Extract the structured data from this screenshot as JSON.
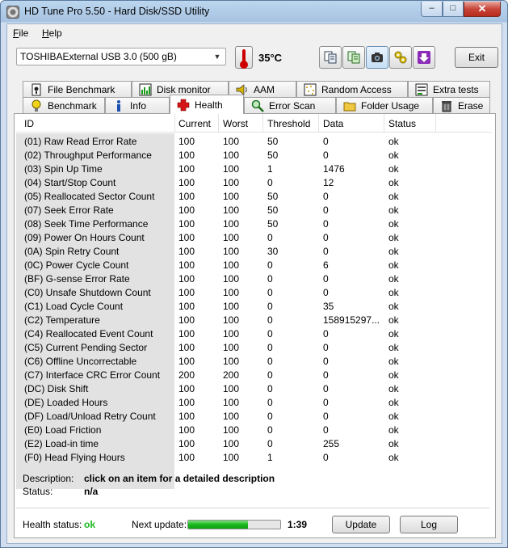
{
  "window": {
    "title": "HD Tune Pro 5.50 - Hard Disk/SSD Utility",
    "min": "–",
    "max": "□",
    "close": "✕"
  },
  "menu": [
    {
      "u": "F",
      "rest": "ile"
    },
    {
      "u": "H",
      "rest": "elp"
    }
  ],
  "toolbar": {
    "drive": "TOSHIBAExternal USB 3.0 (500 gB)",
    "temperature": "35°C",
    "exit": "Exit"
  },
  "tabs_top": [
    "File Benchmark",
    "Disk monitor",
    "AAM",
    "Random Access",
    "Extra tests"
  ],
  "tabs_bottom": [
    "Benchmark",
    "Info",
    "Health",
    "Error Scan",
    "Folder Usage",
    "Erase"
  ],
  "table": {
    "headers": [
      "ID",
      "Current",
      "Worst",
      "Threshold",
      "Data",
      "Status"
    ],
    "rows": [
      [
        "(01) Raw Read Error Rate",
        "100",
        "100",
        "50",
        "0",
        "ok"
      ],
      [
        "(02) Throughput Performance",
        "100",
        "100",
        "50",
        "0",
        "ok"
      ],
      [
        "(03) Spin Up Time",
        "100",
        "100",
        "1",
        "1476",
        "ok"
      ],
      [
        "(04) Start/Stop Count",
        "100",
        "100",
        "0",
        "12",
        "ok"
      ],
      [
        "(05) Reallocated Sector Count",
        "100",
        "100",
        "50",
        "0",
        "ok"
      ],
      [
        "(07) Seek Error Rate",
        "100",
        "100",
        "50",
        "0",
        "ok"
      ],
      [
        "(08) Seek Time Performance",
        "100",
        "100",
        "50",
        "0",
        "ok"
      ],
      [
        "(09) Power On Hours Count",
        "100",
        "100",
        "0",
        "0",
        "ok"
      ],
      [
        "(0A) Spin Retry Count",
        "100",
        "100",
        "30",
        "0",
        "ok"
      ],
      [
        "(0C) Power Cycle Count",
        "100",
        "100",
        "0",
        "6",
        "ok"
      ],
      [
        "(BF) G-sense Error Rate",
        "100",
        "100",
        "0",
        "0",
        "ok"
      ],
      [
        "(C0) Unsafe Shutdown Count",
        "100",
        "100",
        "0",
        "0",
        "ok"
      ],
      [
        "(C1) Load Cycle Count",
        "100",
        "100",
        "0",
        "35",
        "ok"
      ],
      [
        "(C2) Temperature",
        "100",
        "100",
        "0",
        "158915297...",
        "ok"
      ],
      [
        "(C4) Reallocated Event Count",
        "100",
        "100",
        "0",
        "0",
        "ok"
      ],
      [
        "(C5) Current Pending Sector",
        "100",
        "100",
        "0",
        "0",
        "ok"
      ],
      [
        "(C6) Offline Uncorrectable",
        "100",
        "100",
        "0",
        "0",
        "ok"
      ],
      [
        "(C7) Interface CRC Error Count",
        "200",
        "200",
        "0",
        "0",
        "ok"
      ],
      [
        "(DC) Disk Shift",
        "100",
        "100",
        "0",
        "0",
        "ok"
      ],
      [
        "(DE) Loaded Hours",
        "100",
        "100",
        "0",
        "0",
        "ok"
      ],
      [
        "(DF) Load/Unload Retry Count",
        "100",
        "100",
        "0",
        "0",
        "ok"
      ],
      [
        "(E0) Load Friction",
        "100",
        "100",
        "0",
        "0",
        "ok"
      ],
      [
        "(E2) Load-in time",
        "100",
        "100",
        "0",
        "255",
        "ok"
      ],
      [
        "(F0) Head Flying Hours",
        "100",
        "100",
        "1",
        "0",
        "ok"
      ]
    ]
  },
  "details": {
    "description_label": "Description:",
    "description_value": "click on an item for a detailed description",
    "status_label": "Status:",
    "status_value": "n/a"
  },
  "footer": {
    "health_label": "Health status:",
    "health_value": "ok",
    "health_color": "#19b81d",
    "next_update_label": "Next update:",
    "next_update_progress": 0.65,
    "countdown": "1:39",
    "update_button": "Update",
    "log_button": "Log"
  }
}
